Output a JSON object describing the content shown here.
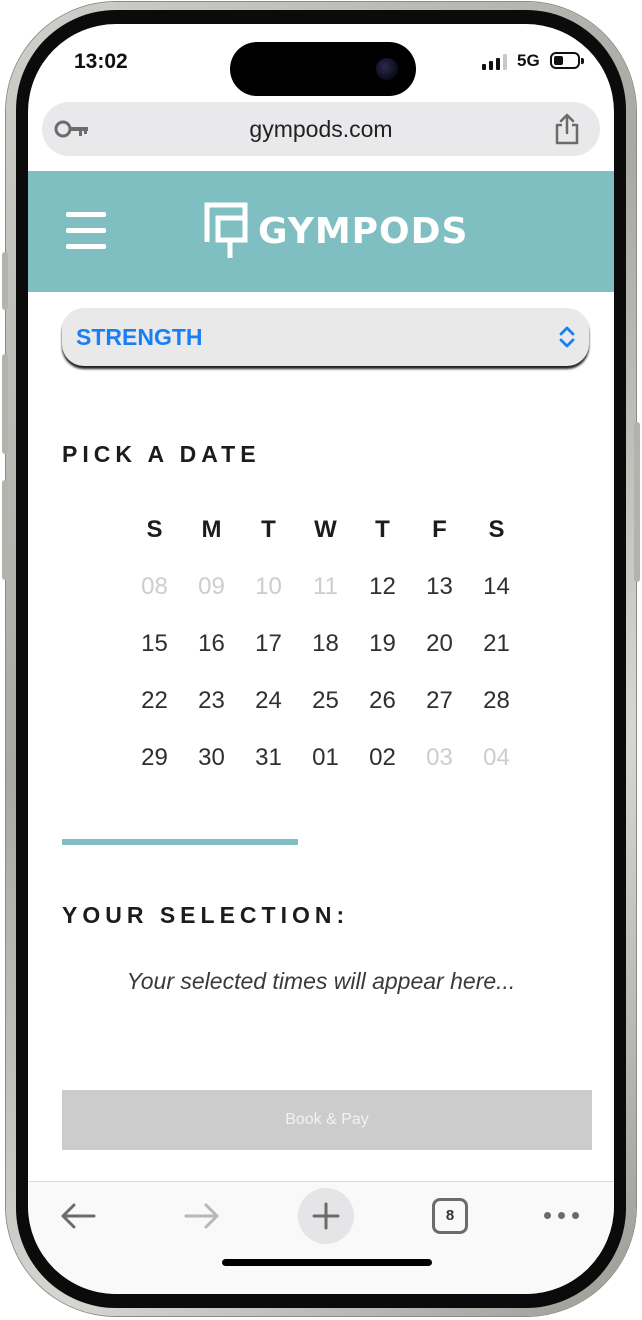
{
  "status_bar": {
    "time": "13:02",
    "network": "5G"
  },
  "browser": {
    "url": "gympods.com",
    "tab_count": "8"
  },
  "site": {
    "brand": "GYMPODS"
  },
  "booking": {
    "category": "STRENGTH",
    "pick_date_heading": "PICK A DATE",
    "weekdays": [
      "S",
      "M",
      "T",
      "W",
      "T",
      "F",
      "S"
    ],
    "calendar_weeks": [
      [
        {
          "day": "08",
          "muted": true
        },
        {
          "day": "09",
          "muted": true
        },
        {
          "day": "10",
          "muted": true
        },
        {
          "day": "11",
          "muted": true
        },
        {
          "day": "12",
          "muted": false
        },
        {
          "day": "13",
          "muted": false
        },
        {
          "day": "14",
          "muted": false
        }
      ],
      [
        {
          "day": "15",
          "muted": false
        },
        {
          "day": "16",
          "muted": false
        },
        {
          "day": "17",
          "muted": false
        },
        {
          "day": "18",
          "muted": false
        },
        {
          "day": "19",
          "muted": false
        },
        {
          "day": "20",
          "muted": false
        },
        {
          "day": "21",
          "muted": false
        }
      ],
      [
        {
          "day": "22",
          "muted": false
        },
        {
          "day": "23",
          "muted": false
        },
        {
          "day": "24",
          "muted": false
        },
        {
          "day": "25",
          "muted": false
        },
        {
          "day": "26",
          "muted": false
        },
        {
          "day": "27",
          "muted": false
        },
        {
          "day": "28",
          "muted": false
        }
      ],
      [
        {
          "day": "29",
          "muted": false
        },
        {
          "day": "30",
          "muted": false
        },
        {
          "day": "31",
          "muted": false
        },
        {
          "day": "01",
          "muted": false
        },
        {
          "day": "02",
          "muted": false
        },
        {
          "day": "03",
          "muted": true
        },
        {
          "day": "04",
          "muted": true
        }
      ]
    ],
    "selection_heading": "YOUR SELECTION:",
    "selection_placeholder": "Your selected times will appear here...",
    "book_button_label": "Book & Pay"
  },
  "colors": {
    "accent": "#80bfc1",
    "select_text": "#1a7ef5",
    "disabled_button": "#cccccc"
  },
  "icons": {
    "browser": [
      "key-icon",
      "share-icon"
    ],
    "site": [
      "menu-icon",
      "gympods-logo-icon"
    ],
    "toolbar": [
      "back-arrow-icon",
      "forward-arrow-icon",
      "plus-icon",
      "tabs-icon",
      "more-icon"
    ]
  }
}
